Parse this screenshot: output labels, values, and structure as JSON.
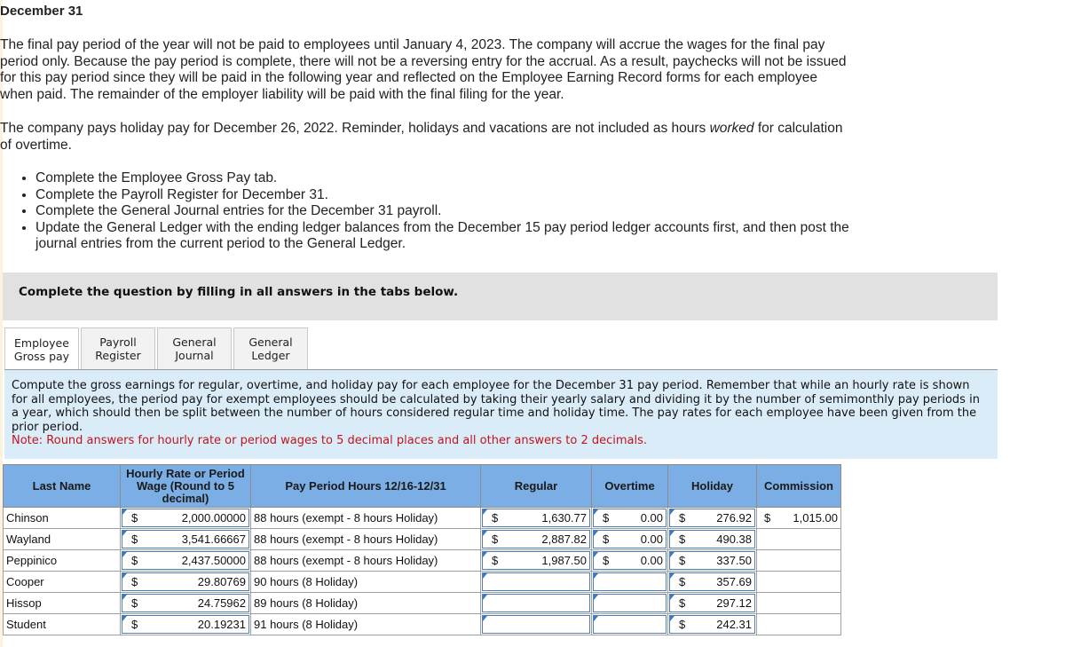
{
  "header": {
    "title": "December 31",
    "paragraph1": "The final pay period of the year will not be paid to employees until January 4, 2023. The company will accrue the wages for the final pay period only. Because the pay period is complete, there will not be a reversing entry for the accrual. As a result, paychecks will not be issued for this pay period since they will be paid in the following year and reflected on the Employee Earning Record forms for each employee when paid. The remainder of the employer liability will be paid with the final filing for the year.",
    "paragraph2_before": "The company pays holiday pay for December 26, 2022. Reminder, holidays and vacations are not included as hours ",
    "paragraph2_em": "worked",
    "paragraph2_after": " for calculation of overtime.",
    "tasks": [
      "Complete the Employee Gross Pay tab.",
      "Complete the Payroll Register for December 31.",
      "Complete the General Journal entries for the December 31 payroll.",
      "Update the General Ledger with the ending ledger balances from the December 15 pay period ledger accounts first, and then post the journal entries from the current period to the General Ledger."
    ]
  },
  "banner": "Complete the question by filling in all answers in the tabs below.",
  "tabs": [
    {
      "line1": "Employee",
      "line2": "Gross pay",
      "active": true
    },
    {
      "line1": "Payroll",
      "line2": "Register",
      "active": false
    },
    {
      "line1": "General",
      "line2": "Journal",
      "active": false
    },
    {
      "line1": "General",
      "line2": "Ledger",
      "active": false
    }
  ],
  "instructions": {
    "text": "Compute the gross earnings for regular, overtime, and holiday pay for each employee for the December 31 pay period. Remember that while an hourly rate is shown for all employees, the period pay for exempt employees should be calculated by taking their yearly salary and dividing it by the number of semimonthly pay periods in a year, which should then be split between the number of hours considered regular time and holiday time.  The pay rates for each employee have been given from the prior period.",
    "note": "Note: Round answers for hourly rate or period wages to 5 decimal places and all other answers to 2 decimals."
  },
  "table": {
    "headers": {
      "last_name": "Last Name",
      "rate": "Hourly Rate or Period Wage (Round to 5 decimal)",
      "hours": "Pay Period Hours 12/16-12/31",
      "regular": "Regular",
      "overtime": "Overtime",
      "holiday": "Holiday",
      "commission": "Commission"
    },
    "currency": "$",
    "rows": [
      {
        "name": "Chinson",
        "rate": "2,000.00000",
        "hours": "88 hours (exempt - 8 hours Holiday)",
        "regular": "1,630.77",
        "overtime": "0.00",
        "holiday": "276.92",
        "commission": "1,015.00"
      },
      {
        "name": "Wayland",
        "rate": "3,541.66667",
        "hours": "88 hours (exempt - 8 hours Holiday)",
        "regular": "2,887.82",
        "overtime": "0.00",
        "holiday": "490.38",
        "commission": ""
      },
      {
        "name": "Peppinico",
        "rate": "2,437.50000",
        "hours": "88 hours (exempt - 8 hours Holiday)",
        "regular": "1,987.50",
        "overtime": "0.00",
        "holiday": "337.50",
        "commission": ""
      },
      {
        "name": "Cooper",
        "rate": "29.80769",
        "hours": "90 hours (8 Holiday)",
        "regular": "",
        "overtime": "",
        "holiday": "357.69",
        "commission": ""
      },
      {
        "name": "Hissop",
        "rate": "24.75962",
        "hours": "89 hours (8 Holiday)",
        "regular": "",
        "overtime": "",
        "holiday": "297.12",
        "commission": ""
      },
      {
        "name": "Student",
        "rate": "20.19231",
        "hours": "91 hours (8 Holiday)",
        "regular": "",
        "overtime": "",
        "holiday": "242.31",
        "commission": ""
      }
    ]
  }
}
